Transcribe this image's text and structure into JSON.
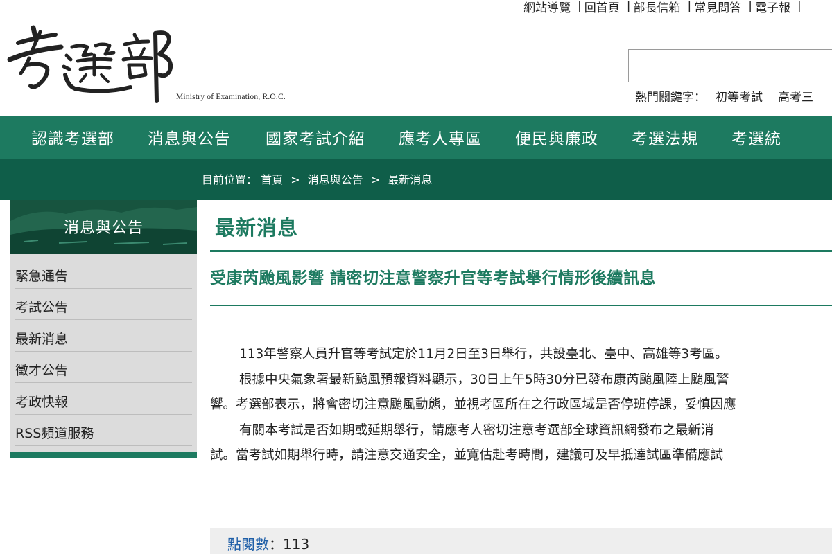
{
  "top_links": [
    "網站導覽",
    "回首頁",
    "部長信箱",
    "常見問答",
    "電子報"
  ],
  "logo": {
    "ministry_name": "考選部",
    "ministry_en": "Ministry of Examination, R.O.C."
  },
  "search": {
    "input_value": "",
    "hot_label": "熱門關鍵字：",
    "hot_keywords": [
      "初等考試",
      "高考三"
    ]
  },
  "main_nav": [
    "認識考選部",
    "消息與公告",
    "國家考試介紹",
    "應考人專區",
    "便民與廉政",
    "考選法規",
    "考選統"
  ],
  "breadcrumb": {
    "label": "目前位置：",
    "items": [
      "首頁",
      "消息與公告",
      "最新消息"
    ]
  },
  "sidebar": {
    "title": "消息與公告",
    "items": [
      "緊急通告",
      "考試公告",
      "最新消息",
      "徵才公告",
      "考政快報",
      "RSS頻道服務"
    ]
  },
  "content": {
    "page_title": "最新消息",
    "article_title": "受康芮颱風影響 請密切注意警察升官等考試舉行情形後續訊息",
    "lines": [
      "113年警察人員升官等考試定於11月2日至3日舉行，共設臺北、臺中、高雄等3考區。",
      "根據中央氣象署最新颱風預報資料顯示，30日上午5時30分已發布康芮颱風陸上颱風警",
      "響。考選部表示，將會密切注意颱風動態，並視考區所在之行政區域是否停班停課，妥慎因應",
      "有關本考試是否如期或延期舉行，請應考人密切注意考選部全球資訊網發布之最新消",
      "試。當考試如期舉行時，請注意交通安全，並寬估赴考時間，建議可及早抵達試區準備應試"
    ]
  },
  "views": {
    "label": "點閱數",
    "sep": "：",
    "count": "113"
  },
  "colors": {
    "nav_green": "#1d7a60",
    "crumb_green": "#0f5e49",
    "title_green": "#1d7a60",
    "views_blue": "#1f5fa8"
  }
}
